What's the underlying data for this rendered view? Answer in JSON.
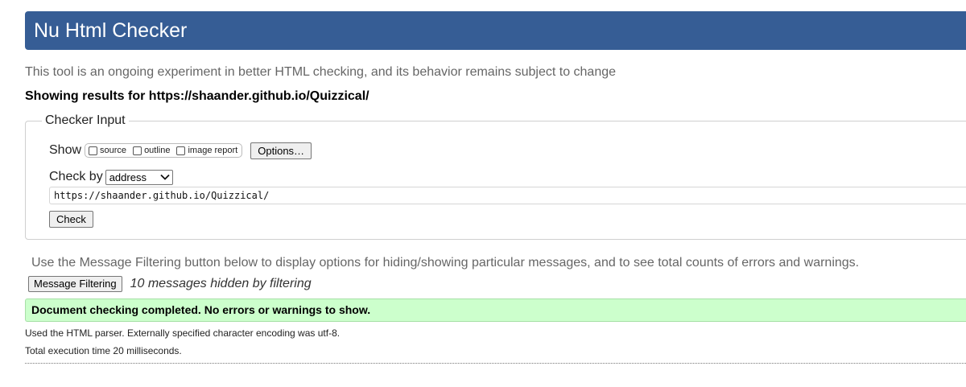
{
  "header": {
    "title": "Nu Html Checker"
  },
  "tagline": "This tool is an ongoing experiment in better HTML checking, and its behavior remains subject to change",
  "showing_results": "Showing results for https://shaander.github.io/Quizzical/",
  "checker_input": {
    "legend": "Checker Input",
    "show_label": "Show",
    "show_options": [
      {
        "label": "source",
        "checked": false
      },
      {
        "label": "outline",
        "checked": false
      },
      {
        "label": "image report",
        "checked": false
      }
    ],
    "options_button": "Options…",
    "check_by_label": "Check by",
    "check_by_value": "address",
    "url_value": "https://shaander.github.io/Quizzical/",
    "check_button": "Check"
  },
  "filtering": {
    "note": "Use the Message Filtering button below to display options for hiding/showing particular messages, and to see total counts of errors and warnings.",
    "button": "Message Filtering",
    "hidden_note": "10 messages hidden by filtering"
  },
  "result": {
    "success_message": "Document checking completed. No errors or warnings to show.",
    "parser_note": "Used the HTML parser. Externally specified character encoding was utf-8.",
    "execution_time": "Total execution time 20 milliseconds."
  },
  "colors": {
    "header_bg": "#365d95",
    "success_bg": "#ccffcc"
  }
}
